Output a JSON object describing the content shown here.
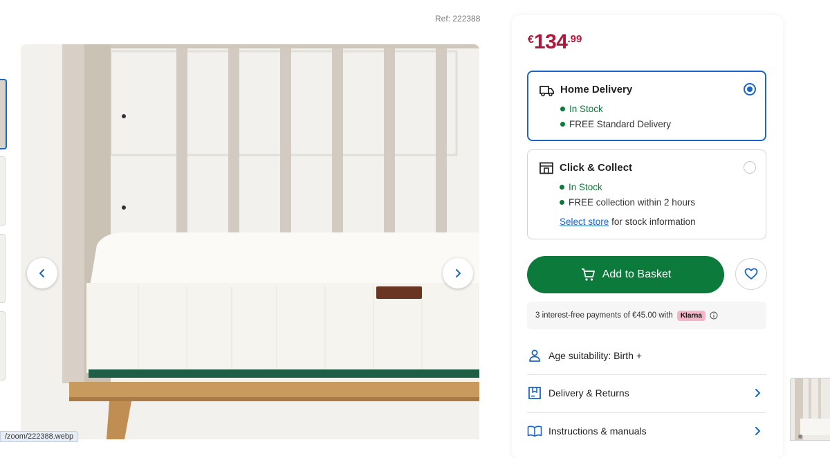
{
  "ref": "Ref: 222388",
  "price": {
    "currency": "€",
    "whole": "134",
    "cents": ".99"
  },
  "delivery_options": [
    {
      "title": "Home Delivery",
      "selected": true,
      "stock": "In Stock",
      "detail": "FREE Standard Delivery"
    },
    {
      "title": "Click & Collect",
      "selected": false,
      "stock": "In Stock",
      "detail": "FREE collection within 2 hours",
      "store_link": "Select store",
      "store_suffix": "for stock information"
    }
  ],
  "basket_button": "Add to Basket",
  "klarna": {
    "text": "3 interest-free payments of €45.00 with",
    "badge": "Klarna"
  },
  "info_rows": [
    {
      "label": "Age suitability: Birth +",
      "icon": "person-icon"
    },
    {
      "label": "Delivery & Returns",
      "icon": "box-icon"
    },
    {
      "label": "Instructions & manuals",
      "icon": "book-icon"
    }
  ],
  "status_url": "/zoom/222388.webp",
  "colors": {
    "price": "#b0173a",
    "accent_blue": "#1a66c8",
    "basket_green": "#0b7a3b",
    "stock_green": "#0b7a3b",
    "klarna_pink": "#f5b5c8"
  }
}
